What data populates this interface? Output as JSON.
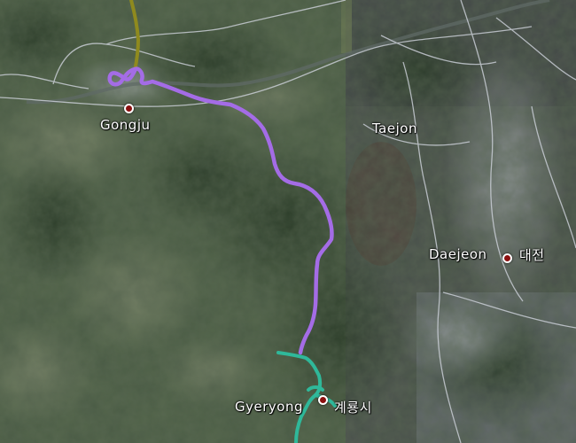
{
  "map": {
    "type": "satellite",
    "place_labels": {
      "gongju": "Gongju",
      "taejon": "Taejon",
      "daejeon": "Daejeon",
      "daejeon_ko": "대전",
      "gyeryong": "Gyeryong",
      "gyeryong_ko": "계룡시"
    },
    "route_colors": {
      "north_segment": "#8f8a1e",
      "middle_segment": "#a46ce6",
      "south_segment": "#2fb89a"
    },
    "road_color": "#cfd3dc"
  }
}
